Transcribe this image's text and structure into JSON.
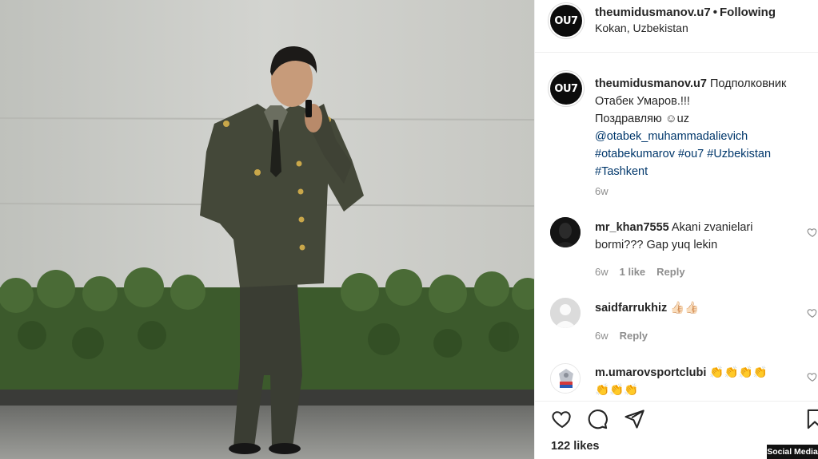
{
  "post": {
    "author": "theumidusmanov.u7",
    "follow_status": "Following",
    "location": "Kokan, Uzbekistan",
    "avatar_text": "OU7"
  },
  "caption": {
    "username": "theumidusmanov.u7",
    "text_line1": " Подполковник",
    "text_line2": "Отабек Умаров.!!!",
    "text_line3": "Поздравляю ☺︎uz",
    "mention": "@otabek_muhammadalievich",
    "hashtags_line1": "#otabekumarov #ou7 #Uzbekistan",
    "hashtags_line2": "#Tashkent",
    "time": "6w"
  },
  "comments": [
    {
      "username": "mr_khan7555",
      "text_line1": " Akani zvanielari",
      "text_line2": "bormi??? Gap yuq lekin",
      "time": "6w",
      "likes": "1 like",
      "reply": "Reply"
    },
    {
      "username": "saidfarrukhiz",
      "text_line1": " 👍🏻👍🏻",
      "time": "6w",
      "reply": "Reply"
    },
    {
      "username": "m.umarovsportclubi",
      "text_line1": " 👏👏👏👏",
      "text_line2": "👏👏👏"
    }
  ],
  "actions": {
    "likes_count": "122 likes",
    "icons": [
      "heart-icon",
      "comment-icon",
      "share-icon",
      "bookmark-icon"
    ]
  },
  "watermark": "Social Media",
  "colors": {
    "link": "#00376b",
    "muted": "#8e8e8e",
    "text": "#262626",
    "border": "#efefef"
  }
}
